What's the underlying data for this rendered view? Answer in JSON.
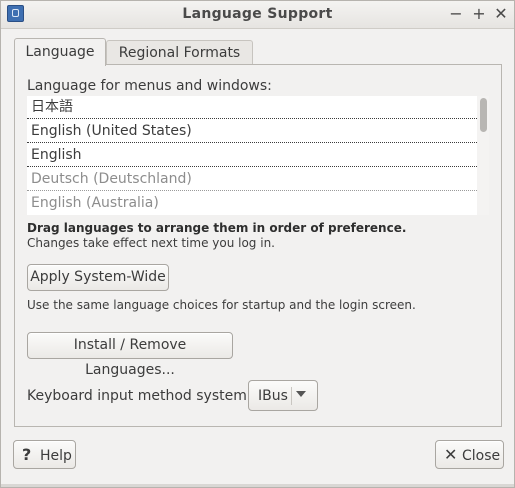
{
  "window": {
    "title": "Language Support",
    "controls": {
      "minimize": "−",
      "maximize": "+",
      "close": "✕"
    }
  },
  "tabs": [
    {
      "label": "Language",
      "active": true
    },
    {
      "label": "Regional Formats",
      "active": false
    }
  ],
  "language": {
    "list_label": "Language for menus and windows:",
    "items": [
      {
        "label": "日本語",
        "enabled": true
      },
      {
        "label": "English (United States)",
        "enabled": true
      },
      {
        "label": "English",
        "enabled": true
      },
      {
        "label": "Deutsch (Deutschland)",
        "enabled": false
      },
      {
        "label": "English (Australia)",
        "enabled": false
      }
    ],
    "drag_hint": "Drag languages to arrange them in order of preference.",
    "effect_hint": "Changes take effect next time you log in.",
    "apply_button": "Apply System-Wide",
    "startup_hint": "Use the same language choices for startup and the login screen.",
    "install_button": "Install / Remove Languages...",
    "keyboard_label": "Keyboard input method system:",
    "keyboard_value": "IBus"
  },
  "footer": {
    "help_label": "Help",
    "close_label": "Close"
  },
  "icons": {
    "help": "question-icon",
    "close": "close-x-icon",
    "app": "language-app-icon"
  },
  "colors": {
    "window_bg": "#f2f1f0",
    "list_bg": "#ffffff",
    "disabled_text": "#8d8d8d"
  }
}
